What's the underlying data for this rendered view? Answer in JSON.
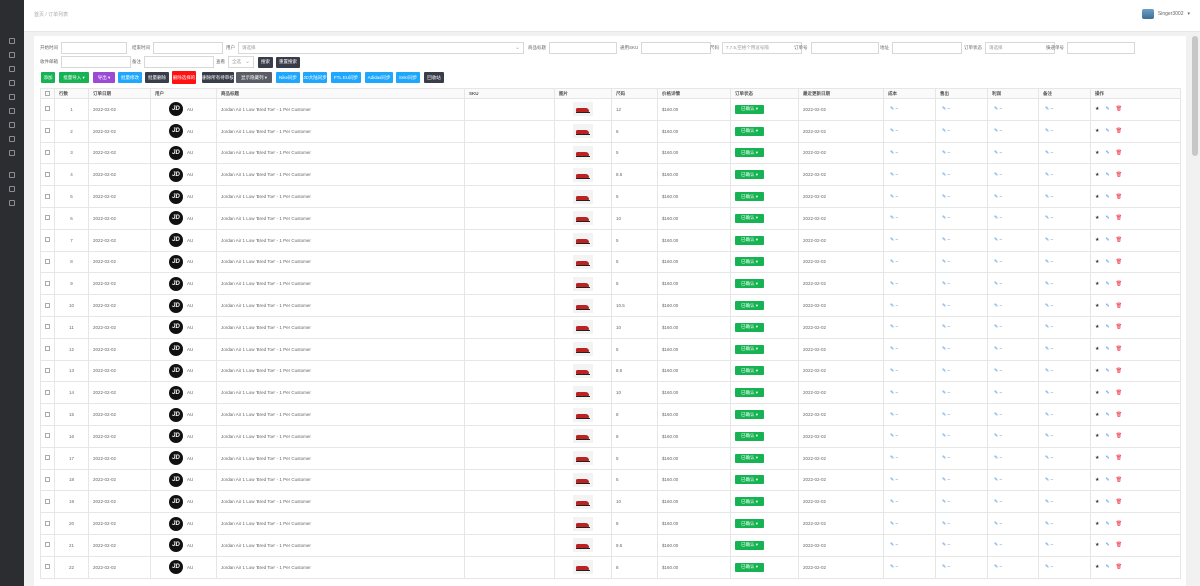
{
  "header": {
    "breadcrumb": "首页 / 订单列表",
    "username": "Singer3002"
  },
  "sidebar": {
    "icons": [
      "doc-icon",
      "close-icon",
      "chart-icon",
      "settings-icon",
      "person-icon",
      "card-icon",
      "folder-icon",
      "group-icon",
      "report-icon",
      "mail-icon",
      "gear-icon",
      "link-icon"
    ]
  },
  "filters": {
    "start_label": "开始时间",
    "end_label": "结束时间",
    "user_label": "用户",
    "user_placeholder": "请选择",
    "title_label": "商品标题",
    "sku_label": "通用SKU",
    "size_label": "尺码",
    "size_placeholder": "7,7.5,空格个用逗号隔",
    "order_label": "订单号",
    "addr_label": "地址",
    "status_label": "订单状态",
    "status_placeholder": "请选择",
    "tracking_label": "快递单号",
    "email_label": "收件邮箱",
    "remark_label": "备注",
    "unique_label": "查看",
    "unique_value": "全选",
    "search_btn": "搜索",
    "reset_btn": "重置搜索"
  },
  "toolbar": {
    "add": "添加",
    "import": "批量导入 ▾",
    "export": "导出 ▾",
    "batch_edit": "批量修改",
    "batch_del": "批量删除",
    "del_selected": "删除选择的",
    "del_dup": "删除所有待审核",
    "show_cols": "显示隐藏列 ▾",
    "nike_sync": "Nike同步",
    "jd_sync": "JD大陆同步",
    "ftl_sync": "FTL EU同步",
    "adidas_sync": "Adidas同步",
    "snkrs_sync": "Snkr同步",
    "recycle": "回收站"
  },
  "table": {
    "headers": [
      "",
      "行数",
      "订单日期",
      "用户",
      "商品标题",
      "SKU",
      "图片",
      "尺码",
      "价格详情",
      "订单状态",
      "最近更新日期",
      "成本",
      "售出",
      "利润",
      "备注",
      "操作"
    ],
    "rows": [
      {
        "n": "1",
        "date": "2022-02-02",
        "logo": "JD",
        "region": "AU",
        "title": "Jordan Air 1 Low 'Bred Toe' - 1 Per Customer",
        "size": "12",
        "price": "$160.00",
        "status": "已确认 ▾",
        "updated": "2022-02-02"
      },
      {
        "n": "2",
        "date": "2022-02-02",
        "logo": "JD",
        "region": "AU",
        "title": "Jordan Air 1 Low 'Bred Toe' - 1 Per Customer",
        "size": "6",
        "price": "$160.00",
        "status": "已确认 ▾",
        "updated": "2022-02-02"
      },
      {
        "n": "3",
        "date": "2022-02-02",
        "logo": "JD",
        "region": "AU",
        "title": "Jordan Air 1 Low 'Bred Toe' - 1 Per Customer",
        "size": "5",
        "price": "$160.00",
        "status": "已确认 ▾",
        "updated": "2022-02-02"
      },
      {
        "n": "4",
        "date": "2022-02-02",
        "logo": "JD",
        "region": "AU",
        "title": "Jordan Air 1 Low 'Bred Toe' - 1 Per Customer",
        "size": "8.5",
        "price": "$160.00",
        "status": "已确认 ▾",
        "updated": "2022-02-02"
      },
      {
        "n": "5",
        "date": "2022-02-02",
        "logo": "JD",
        "region": "AU",
        "title": "Jordan Air 1 Low 'Bred Toe' - 1 Per Customer",
        "size": "5",
        "price": "$160.00",
        "status": "已确认 ▾",
        "updated": "2022-02-02"
      },
      {
        "n": "6",
        "date": "2022-02-02",
        "logo": "JD",
        "region": "AU",
        "title": "Jordan Air 1 Low 'Bred Toe' - 1 Per Customer",
        "size": "10",
        "price": "$160.00",
        "status": "已确认 ▾",
        "updated": "2022-02-02"
      },
      {
        "n": "7",
        "date": "2022-02-02",
        "logo": "JD",
        "region": "AU",
        "title": "Jordan Air 1 Low 'Bred Toe' - 1 Per Customer",
        "size": "5",
        "price": "$160.00",
        "status": "已确认 ▾",
        "updated": "2022-02-02"
      },
      {
        "n": "8",
        "date": "2022-02-02",
        "logo": "JD",
        "region": "AU",
        "title": "Jordan Air 1 Low 'Bred Toe' - 1 Per Customer",
        "size": "5",
        "price": "$160.00",
        "status": "已确认 ▾",
        "updated": "2022-02-02"
      },
      {
        "n": "9",
        "date": "2022-02-02",
        "logo": "JD",
        "region": "AU",
        "title": "Jordan Air 1 Low 'Bred Toe' - 1 Per Customer",
        "size": "5",
        "price": "$160.00",
        "status": "已确认 ▾",
        "updated": "2022-02-02"
      },
      {
        "n": "10",
        "date": "2022-02-02",
        "logo": "JD",
        "region": "AU",
        "title": "Jordan Air 1 Low 'Bred Toe' - 1 Per Customer",
        "size": "10.5",
        "price": "$160.00",
        "status": "已确认 ▾",
        "updated": "2022-02-02"
      },
      {
        "n": "11",
        "date": "2022-02-02",
        "logo": "JD",
        "region": "AU",
        "title": "Jordan Air 1 Low 'Bred Toe' - 1 Per Customer",
        "size": "10",
        "price": "$160.00",
        "status": "已确认 ▾",
        "updated": "2022-02-02"
      },
      {
        "n": "12",
        "date": "2022-02-02",
        "logo": "JD",
        "region": "AU",
        "title": "Jordan Air 1 Low 'Bred Toe' - 1 Per Customer",
        "size": "5",
        "price": "$160.00",
        "status": "已确认 ▾",
        "updated": "2022-02-02"
      },
      {
        "n": "13",
        "date": "2022-02-02",
        "logo": "JD",
        "region": "AU",
        "title": "Jordan Air 1 Low 'Bred Toe' - 1 Per Customer",
        "size": "8.5",
        "price": "$160.00",
        "status": "已确认 ▾",
        "updated": "2022-02-02"
      },
      {
        "n": "14",
        "date": "2022-02-02",
        "logo": "JD",
        "region": "AU",
        "title": "Jordan Air 1 Low 'Bred Toe' - 1 Per Customer",
        "size": "10",
        "price": "$160.00",
        "status": "已确认 ▾",
        "updated": "2022-02-02"
      },
      {
        "n": "15",
        "date": "2022-02-02",
        "logo": "JD",
        "region": "AU",
        "title": "Jordan Air 1 Low 'Bred Toe' - 1 Per Customer",
        "size": "8",
        "price": "$160.00",
        "status": "已确认 ▾",
        "updated": "2022-02-02"
      },
      {
        "n": "16",
        "date": "2022-02-02",
        "logo": "JD",
        "region": "AU",
        "title": "Jordan Air 1 Low 'Bred Toe' - 1 Per Customer",
        "size": "8",
        "price": "$160.00",
        "status": "已确认 ▾",
        "updated": "2022-02-02"
      },
      {
        "n": "17",
        "date": "2022-02-02",
        "logo": "JD",
        "region": "AU",
        "title": "Jordan Air 1 Low 'Bred Toe' - 1 Per Customer",
        "size": "5",
        "price": "$160.00",
        "status": "已确认 ▾",
        "updated": "2022-02-02"
      },
      {
        "n": "18",
        "date": "2022-02-02",
        "logo": "JD",
        "region": "AU",
        "title": "Jordan Air 1 Low 'Bred Toe' - 1 Per Customer",
        "size": "5",
        "price": "$160.00",
        "status": "已确认 ▾",
        "updated": "2022-02-02"
      },
      {
        "n": "19",
        "date": "2022-02-02",
        "logo": "JD",
        "region": "AU",
        "title": "Jordan Air 1 Low 'Bred Toe' - 1 Per Customer",
        "size": "10",
        "price": "$160.00",
        "status": "已确认 ▾",
        "updated": "2022-02-02"
      },
      {
        "n": "20",
        "date": "2022-02-02",
        "logo": "JD",
        "region": "AU",
        "title": "Jordan Air 1 Low 'Bred Toe' - 1 Per Customer",
        "size": "8",
        "price": "$160.00",
        "status": "已确认 ▾",
        "updated": "2022-02-02"
      },
      {
        "n": "21",
        "date": "2022-02-02",
        "logo": "JD",
        "region": "AU",
        "title": "Jordan Air 1 Low 'Bred Toe' - 1 Per Customer",
        "size": "9.5",
        "price": "$160.00",
        "status": "已确认 ▾",
        "updated": "2022-02-02"
      },
      {
        "n": "22",
        "date": "2022-02-02",
        "logo": "JD",
        "region": "AU",
        "title": "Jordan Air 1 Low 'Bred Toe' - 1 Per Customer",
        "size": "8",
        "price": "$160.00",
        "status": "已确认 ▾",
        "updated": "2022-02-02"
      }
    ],
    "edit_icon_text": "–",
    "colors": {
      "status": "#16b352",
      "edit": "#3a8ee6",
      "delete": "#e22233"
    }
  }
}
